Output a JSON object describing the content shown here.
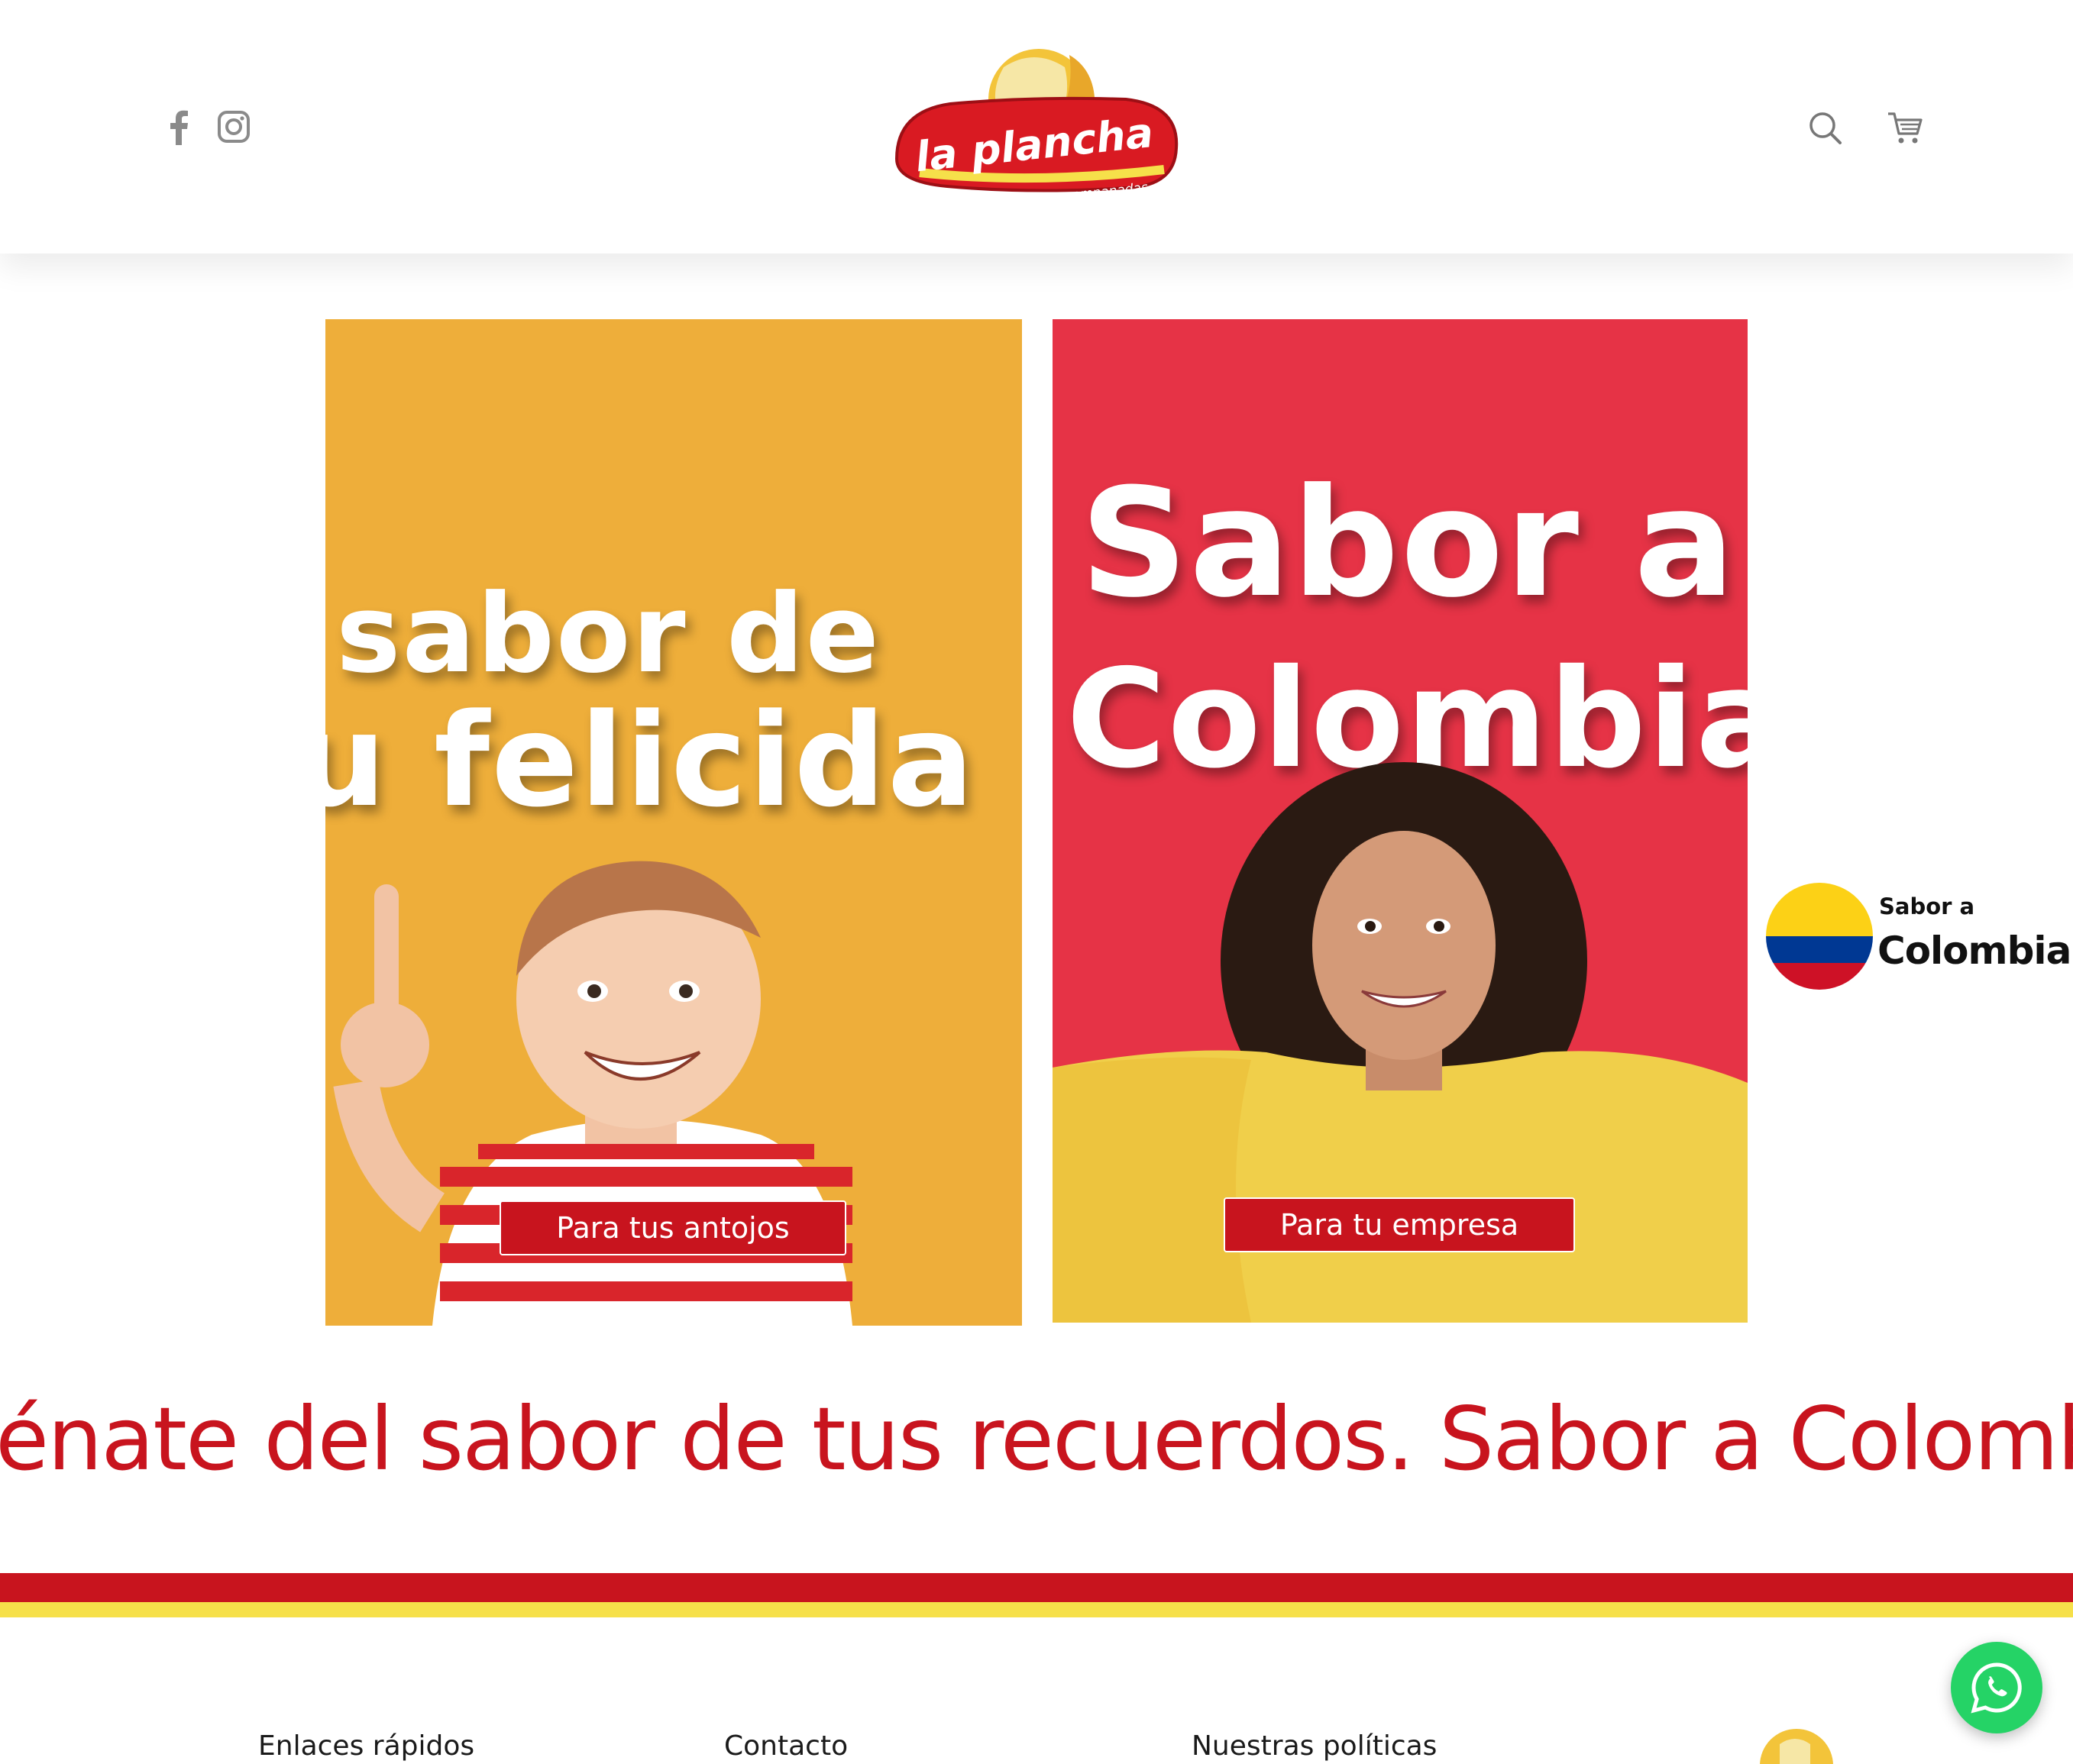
{
  "header": {
    "social": [
      {
        "name": "facebook-icon"
      },
      {
        "name": "instagram-icon"
      }
    ],
    "logo": {
      "brand": "la plancha",
      "tagline": "Arepas y empanadas"
    },
    "actions": [
      {
        "name": "search-icon"
      },
      {
        "name": "cart-icon"
      }
    ]
  },
  "cards": [
    {
      "headline_line1": "sabor de",
      "headline_line2": "u felicida",
      "button_label": "Para tus antojos",
      "background": "#EEAE3A"
    },
    {
      "headline_line1": "Sabor a",
      "headline_line2": "Colombia",
      "button_label": "Para tu empresa",
      "background": "#E63346"
    }
  ],
  "badge": {
    "small": "Sabor a",
    "big": "Colombia",
    "flag_colors": [
      "#FCD116",
      "#003893",
      "#CE1126"
    ]
  },
  "tagline": "énate del sabor de tus recuerdos. Sabor a Colombia!",
  "colors": {
    "brand_red": "#C8141E",
    "brand_yellow": "#F6E04A",
    "whatsapp_green": "#25D366"
  },
  "footer": {
    "columns": [
      "Enlaces rápidos",
      "Contacto",
      "Nuestras políticas"
    ]
  }
}
